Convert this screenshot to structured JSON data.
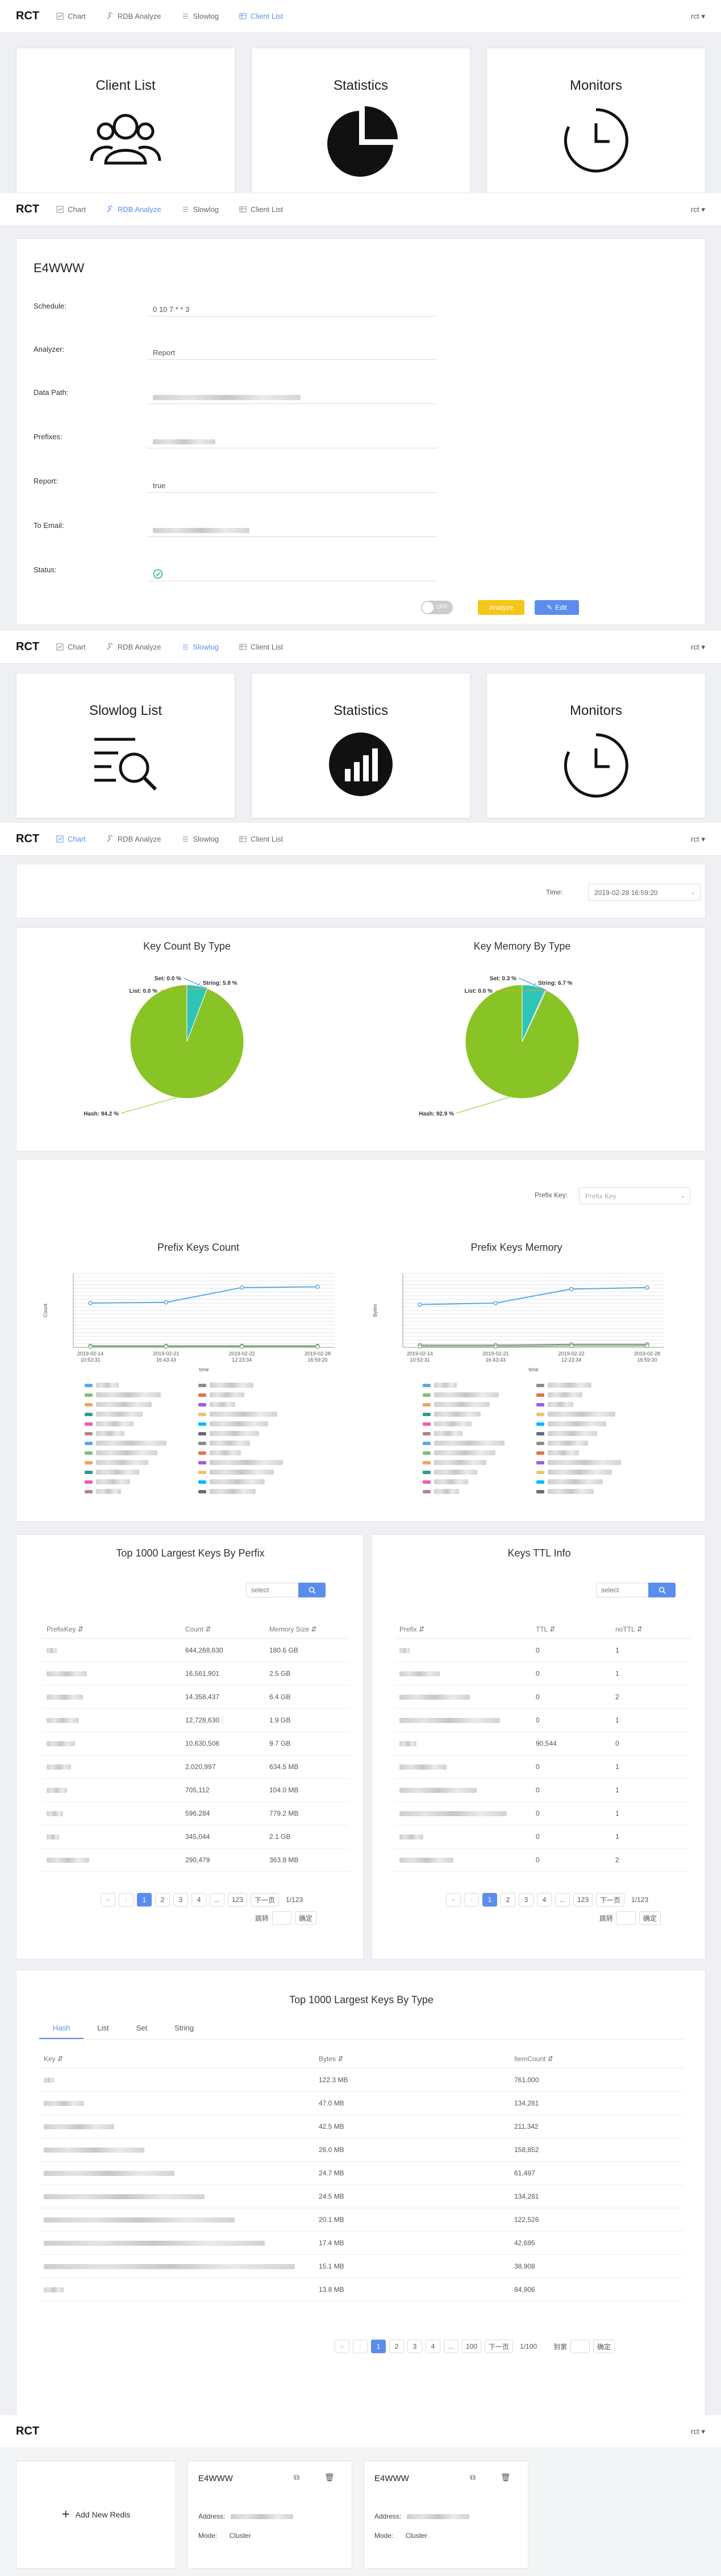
{
  "logo": "RCT",
  "user_menu": "rct",
  "nav": {
    "chart": "Chart",
    "rdb": "RDB Analyze",
    "slowlog": "Slowlog",
    "client_list": "Client List"
  },
  "client_cards": [
    "Client List",
    "Statistics",
    "Monitors"
  ],
  "slowlog_cards": [
    "Slowlog List",
    "Statistics",
    "Monitors"
  ],
  "rdb_form": {
    "title": "E4WWW",
    "schedule_label": "Schedule:",
    "schedule_value": "0 10 7 * * 3",
    "analyzer_label": "Analyzer:",
    "analyzer_value": "Report",
    "datapath_label": "Data Path:",
    "prefixes_label": "Prefixes:",
    "report_label": "Report:",
    "report_value": "true",
    "email_label": "To Email:",
    "status_label": "Status:",
    "toggle_label": "OFF",
    "analyze_button": "Analyze",
    "edit_button": "Edit"
  },
  "time_filter": {
    "label": "Time:",
    "value": "2019-02-28 16:59:20"
  },
  "pie_charts": {
    "count_title": "Key Count By Type",
    "memory_title": "Key Memory By Type"
  },
  "prefix_filter": {
    "label": "Prefix Key:",
    "placeholder": "Prefix Key"
  },
  "line_charts": {
    "count_title": "Prefix Keys Count",
    "count_ylabel": "Count",
    "memory_title": "Prefix Keys Memory",
    "memory_ylabel": "Bytes",
    "xlabel": "time",
    "x_ticks": [
      [
        "2019-02-14",
        "10:53:31"
      ],
      [
        "2019-02-21",
        "16:43:43"
      ],
      [
        "2019-02-22",
        "12:23:34"
      ],
      [
        "2019-02-28",
        "16:59:20"
      ]
    ],
    "memory_x_ticks": [
      [
        "2019-02-14",
        "10:53:31"
      ],
      [
        "2019-02-21",
        "16:43:43"
      ],
      [
        "2019-02-22",
        "12:23:34"
      ],
      [
        "2019-02-28",
        "16:59:20"
      ]
    ]
  },
  "chart_data": [
    {
      "type": "pie",
      "title": "Key Count By Type",
      "labels": [
        "Hash",
        "String",
        "Set",
        "List"
      ],
      "values": [
        94.2,
        5.8,
        0.0,
        0.0
      ],
      "label_text": [
        "Hash: 94.2 %",
        "String: 5.8 %",
        "Set: 0.0 %",
        "List: 0.0 %"
      ],
      "colors": [
        "#88c425",
        "#2ec4b6",
        "#3b82c4",
        "#f0a030"
      ]
    },
    {
      "type": "pie",
      "title": "Key Memory By Type",
      "labels": [
        "Hash",
        "String",
        "Set",
        "List"
      ],
      "values": [
        92.9,
        6.7,
        0.3,
        0.0
      ],
      "label_text": [
        "Hash: 92.9 %",
        "String: 6.7 %",
        "Set: 0.3 %",
        "List: 0.0 %"
      ],
      "colors": [
        "#88c425",
        "#2ec4b6",
        "#3b82c4",
        "#f0a030"
      ]
    },
    {
      "type": "line",
      "title": "Prefix Keys Count",
      "ylabel": "Count",
      "xlabel": "time",
      "series": [
        {
          "values": [
            0.6,
            0.61,
            0.81,
            0.82
          ],
          "color": "#5aa9e6"
        },
        {
          "values": [
            0.02,
            0.02,
            0.02,
            0.02
          ],
          "color": "#8c8c8c"
        },
        {
          "values": [
            0.01,
            0.01,
            0.01,
            0.01
          ],
          "color": "#7fbf7f"
        }
      ]
    },
    {
      "type": "line",
      "title": "Prefix Keys Memory",
      "ylabel": "Bytes",
      "xlabel": "time",
      "series": [
        {
          "values": [
            0.58,
            0.6,
            0.79,
            0.81
          ],
          "color": "#5aa9e6"
        },
        {
          "values": [
            0.03,
            0.03,
            0.04,
            0.04
          ],
          "color": "#8c8c8c"
        },
        {
          "values": [
            0.01,
            0.01,
            0.02,
            0.02
          ],
          "color": "#7fbf7f"
        }
      ]
    }
  ],
  "largest_by_prefix": {
    "title": "Top 1000 Largest Keys By Perfix",
    "search_placeholder": "select",
    "headers": [
      "PrefixKey",
      "Count",
      "Memory Size"
    ],
    "rows": [
      [
        "644,268,630",
        "180.6 GB"
      ],
      [
        "16,561,901",
        "2.5 GB"
      ],
      [
        "14,358,437",
        "6.4 GB"
      ],
      [
        "12,728,630",
        "1.9 GB"
      ],
      [
        "10,630,506",
        "9.7 GB"
      ],
      [
        "2,020,997",
        "634.5 MB"
      ],
      [
        "705,112",
        "104.0 MB"
      ],
      [
        "596,284",
        "779.2 MB"
      ],
      [
        "345,044",
        "2.1 GB"
      ],
      [
        "290,479",
        "363.8 MB"
      ]
    ],
    "pages": [
      "1",
      "2",
      "3",
      "4",
      "...",
      "123"
    ],
    "next": "下一页",
    "total": "1/123",
    "jump_label": "跳转",
    "ok": "确定"
  },
  "ttl_info": {
    "title": "Keys TTL Info",
    "search_placeholder": "select",
    "headers": [
      "Prefix",
      "TTL",
      "noTTL"
    ],
    "rows": [
      [
        "0",
        "1"
      ],
      [
        "0",
        "1"
      ],
      [
        "0",
        "2"
      ],
      [
        "0",
        "1"
      ],
      [
        "90,544",
        "0"
      ],
      [
        "0",
        "1"
      ],
      [
        "0",
        "1"
      ],
      [
        "0",
        "1"
      ],
      [
        "0",
        "1"
      ],
      [
        "0",
        "2"
      ]
    ],
    "pages": [
      "1",
      "2",
      "3",
      "4",
      "...",
      "123"
    ],
    "next": "下一页",
    "total": "1/123",
    "jump_label": "跳转",
    "ok": "确定"
  },
  "largest_by_type": {
    "title": "Top 1000 Largest Keys By Type",
    "tabs": [
      "Hash",
      "List",
      "Set",
      "String"
    ],
    "headers": [
      "Key",
      "Bytes",
      "ItemCount"
    ],
    "rows": [
      [
        "122.3 MB",
        "761,000"
      ],
      [
        "47.0 MB",
        "134,281"
      ],
      [
        "42.5 MB",
        "211,342"
      ],
      [
        "26.0 MB",
        "158,852"
      ],
      [
        "24.7 MB",
        "61,497"
      ],
      [
        "24.5 MB",
        "134,281"
      ],
      [
        "20.1 MB",
        "122,526"
      ],
      [
        "17.4 MB",
        "42,695"
      ],
      [
        "15.1 MB",
        "38,908"
      ],
      [
        "13.8 MB",
        "84,906"
      ]
    ],
    "pages": [
      "1",
      "2",
      "3",
      "4",
      "...",
      "100"
    ],
    "next": "下一页",
    "total": "1/100",
    "jump_label": "到第",
    "ok": "确定"
  },
  "redis_list": {
    "add_label": "Add New Redis",
    "cards": [
      {
        "name": "E4WWW",
        "address_label": "Address:",
        "mode_label": "Mode:",
        "mode": "Cluster"
      },
      {
        "name": "E4WWW",
        "address_label": "Address:",
        "mode_label": "Mode:",
        "mode": "Cluster"
      }
    ]
  },
  "accent_color": "#5b8def",
  "warning_color": "#f5c518"
}
